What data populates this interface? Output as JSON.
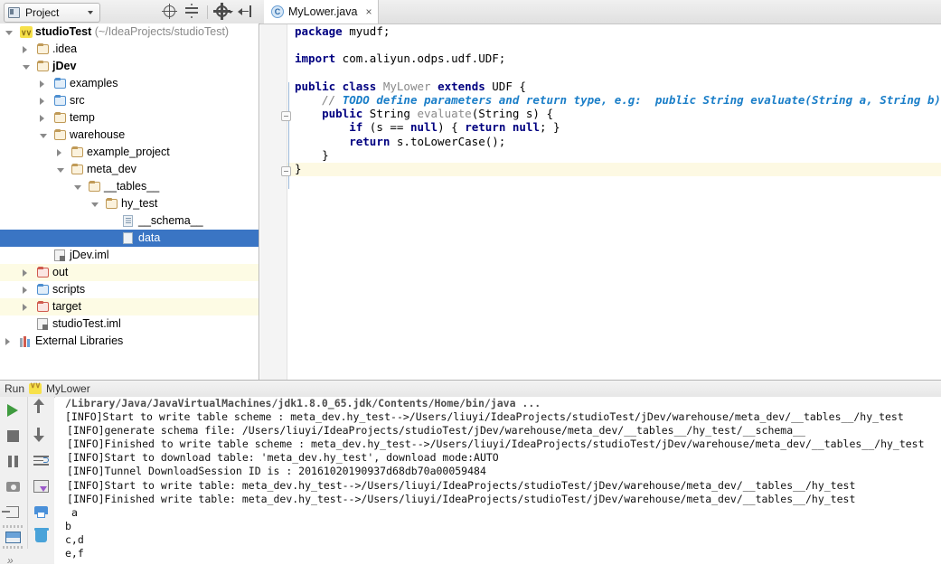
{
  "toolbar": {
    "project_label": "Project",
    "icons": [
      "locate-target-icon",
      "collapse-all-icon",
      "settings-gear-icon",
      "hide-panel-icon"
    ]
  },
  "editor_tabs": [
    {
      "label": "MyLower.java",
      "icon": "java-class-icon",
      "close": "×",
      "active": true
    }
  ],
  "tree": {
    "items": [
      {
        "label": "studioTest",
        "path_suffix": " (~/IdeaProjects/studioTest)",
        "indent": 0,
        "arrow": "open",
        "icon": "module-icon",
        "bold": true
      },
      {
        "label": ".idea",
        "indent": 1,
        "arrow": "closed",
        "icon": "folder-tan"
      },
      {
        "label": "jDev",
        "indent": 1,
        "arrow": "open",
        "icon": "folder-tan",
        "bold": true
      },
      {
        "label": "examples",
        "indent": 2,
        "arrow": "closed",
        "icon": "folder-blue"
      },
      {
        "label": "src",
        "indent": 2,
        "arrow": "closed",
        "icon": "folder-blue"
      },
      {
        "label": "temp",
        "indent": 2,
        "arrow": "closed",
        "icon": "folder-tan"
      },
      {
        "label": "warehouse",
        "indent": 2,
        "arrow": "open",
        "icon": "folder-tan"
      },
      {
        "label": "example_project",
        "indent": 3,
        "arrow": "closed",
        "icon": "folder-tan"
      },
      {
        "label": "meta_dev",
        "indent": 3,
        "arrow": "open",
        "icon": "folder-tan"
      },
      {
        "label": "__tables__",
        "indent": 4,
        "arrow": "open",
        "icon": "folder-tan"
      },
      {
        "label": "hy_test",
        "indent": 5,
        "arrow": "open",
        "icon": "folder-tan"
      },
      {
        "label": "__schema__",
        "indent": 6,
        "icon": "file-text-icon"
      },
      {
        "label": "data",
        "indent": 6,
        "icon": "file-icon",
        "selected": true
      },
      {
        "label": "jDev.iml",
        "indent": 2,
        "icon": "iml-file-icon"
      },
      {
        "label": "out",
        "indent": 1,
        "arrow": "closed",
        "icon": "folder-red",
        "excluded": true
      },
      {
        "label": "scripts",
        "indent": 1,
        "arrow": "closed",
        "icon": "folder-blue"
      },
      {
        "label": "target",
        "indent": 1,
        "arrow": "closed",
        "icon": "folder-red",
        "excluded": true
      },
      {
        "label": "studioTest.iml",
        "indent": 1,
        "icon": "iml-file-icon"
      },
      {
        "label": "External Libraries",
        "indent": 0,
        "arrow": "closed",
        "icon": "libraries-icon"
      }
    ]
  },
  "code": {
    "lines": [
      [
        {
          "t": "package",
          "c": "kw"
        },
        {
          "t": " myudf;",
          "c": ""
        }
      ],
      [],
      [
        {
          "t": "import",
          "c": "kw"
        },
        {
          "t": " com.aliyun.odps.udf.UDF;",
          "c": ""
        }
      ],
      [],
      [
        {
          "t": "public class",
          "c": "kw"
        },
        {
          "t": " ",
          "c": ""
        },
        {
          "t": "MyLower",
          "c": "cls"
        },
        {
          "t": " ",
          "c": ""
        },
        {
          "t": "extends",
          "c": "kw"
        },
        {
          "t": " UDF {",
          "c": ""
        }
      ],
      [
        {
          "t": "    ",
          "c": ""
        },
        {
          "t": "// ",
          "c": "cmt"
        },
        {
          "t": "TODO define parameters and return type, e.g:  public String evaluate(String a, String b)",
          "c": "todo"
        }
      ],
      [
        {
          "t": "    ",
          "c": ""
        },
        {
          "t": "public",
          "c": "kw"
        },
        {
          "t": " String ",
          "c": ""
        },
        {
          "t": "evaluate",
          "c": "cls"
        },
        {
          "t": "(String s) {",
          "c": ""
        }
      ],
      [
        {
          "t": "        ",
          "c": ""
        },
        {
          "t": "if",
          "c": "kw"
        },
        {
          "t": " (s == ",
          "c": ""
        },
        {
          "t": "null",
          "c": "kw"
        },
        {
          "t": ") { ",
          "c": ""
        },
        {
          "t": "return null",
          "c": "kw"
        },
        {
          "t": "; }",
          "c": ""
        }
      ],
      [
        {
          "t": "        ",
          "c": ""
        },
        {
          "t": "return",
          "c": "kw"
        },
        {
          "t": " s.toLowerCase();",
          "c": ""
        }
      ],
      [
        {
          "t": "    }",
          "c": ""
        }
      ],
      [
        {
          "t": "}",
          "c": "",
          "caret": true
        }
      ]
    ],
    "caret_line_index": 10
  },
  "run_panel": {
    "title": "Run",
    "config_name": "MyLower",
    "left_tools": [
      "run-icon",
      "stop-icon",
      "pause-icon",
      "screenshot-icon",
      "export-icon",
      "layout-icon",
      "more-icon"
    ],
    "right_tools": [
      "scroll-up-icon",
      "scroll-down-icon",
      "soft-wrap-icon",
      "scroll-to-end-icon",
      "print-icon",
      "clear-all-icon"
    ],
    "console_lines": [
      {
        "text": "/Library/Java/JavaVirtualMachines/jdk1.8.0_65.jdk/Contents/Home/bin/java ...",
        "style": "cmd",
        "indent": 11
      },
      {
        "text": "[INFO]Start to write table scheme : meta_dev.hy_test-->/Users/liuyi/IdeaProjects/studioTest/jDev/warehouse/meta_dev/__tables__/hy_test",
        "style": "out",
        "indent": 11
      },
      {
        "text": "[INFO]generate schema file: /Users/liuyi/IdeaProjects/studioTest/jDev/warehouse/meta_dev/__tables__/hy_test/__schema__",
        "style": "out",
        "indent": 13
      },
      {
        "text": "[INFO]Finished to write table scheme : meta_dev.hy_test-->/Users/liuyi/IdeaProjects/studioTest/jDev/warehouse/meta_dev/__tables__/hy_test",
        "style": "out",
        "indent": 13
      },
      {
        "text": "[INFO]Start to download table: 'meta_dev.hy_test', download mode:AUTO",
        "style": "out",
        "indent": 13
      },
      {
        "text": "[INFO]Tunnel DownloadSession ID is : 20161020190937d68db70a00059484",
        "style": "out",
        "indent": 13
      },
      {
        "text": "[INFO]Start to write table: meta_dev.hy_test-->/Users/liuyi/IdeaProjects/studioTest/jDev/warehouse/meta_dev/__tables__/hy_test",
        "style": "out",
        "indent": 13
      },
      {
        "text": "[INFO]Finished write table: meta_dev.hy_test-->/Users/liuyi/IdeaProjects/studioTest/jDev/warehouse/meta_dev/__tables__/hy_test",
        "style": "out",
        "indent": 13
      },
      {
        "text": "a",
        "style": "out",
        "indent": 18
      },
      {
        "text": "b",
        "style": "out",
        "indent": 11
      },
      {
        "text": "c,d",
        "style": "out",
        "indent": 11
      },
      {
        "text": "e,f",
        "style": "out",
        "indent": 11
      }
    ]
  },
  "colors": {
    "selection_blue": "#3a75c4",
    "excluded_yellow": "#fdfbe4",
    "caret_line": "#fdf9e3",
    "keyword": "#000080",
    "todo": "#1a7ec8",
    "run_green": "#3f9b3f"
  }
}
